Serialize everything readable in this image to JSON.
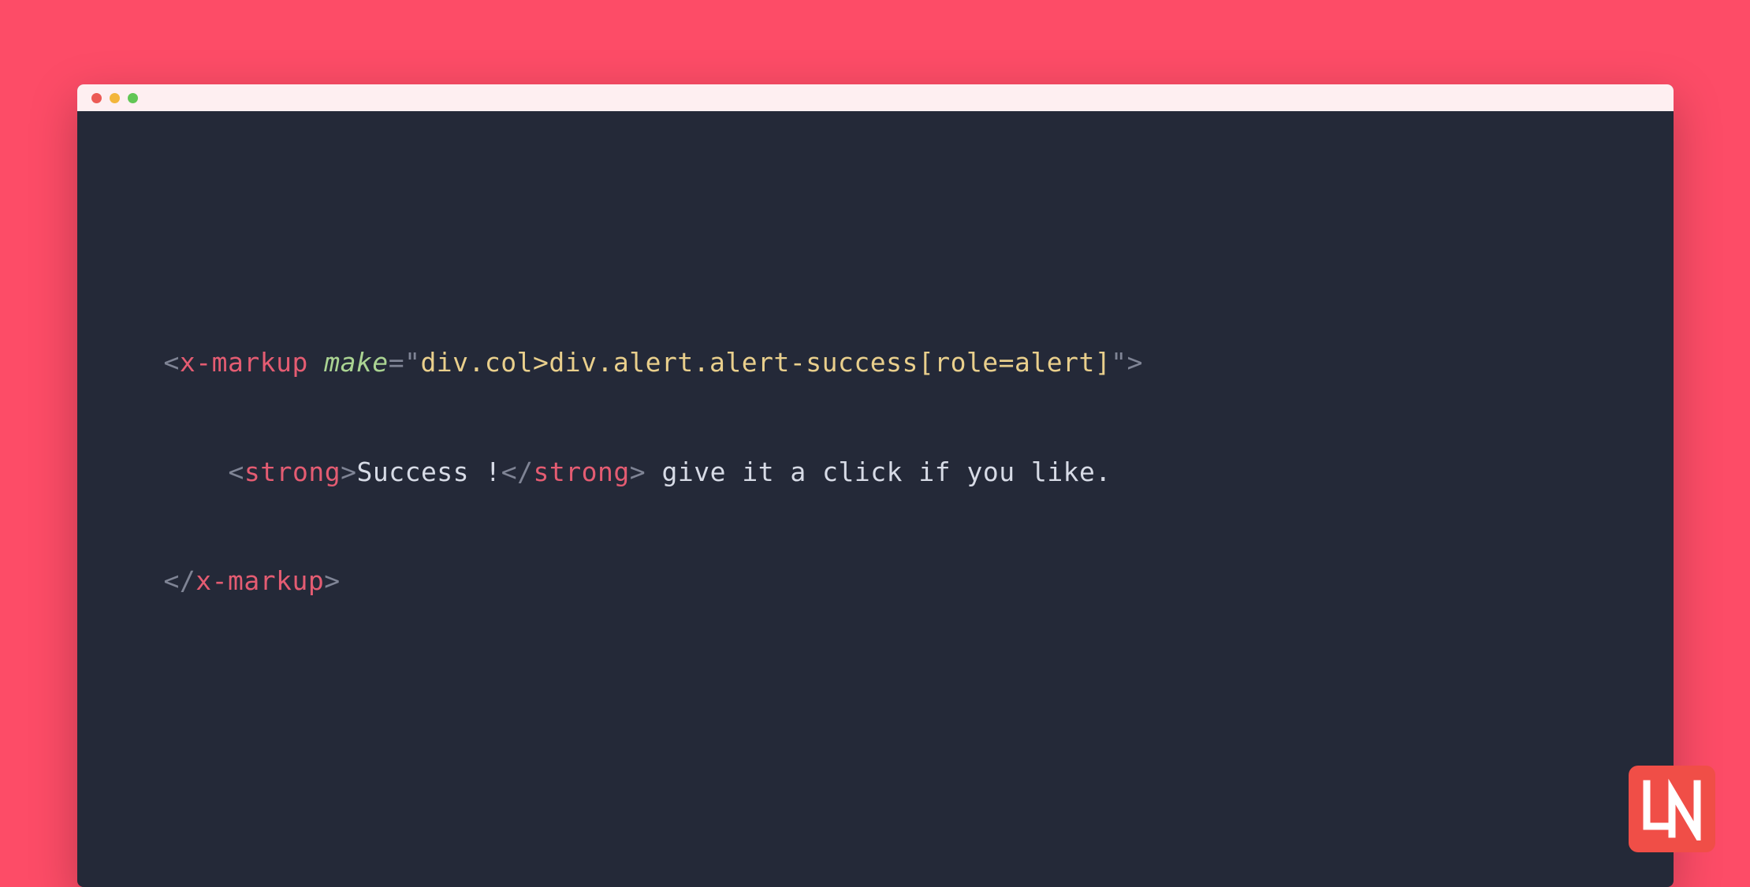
{
  "code": {
    "line1": {
      "open_bracket": "<",
      "tag": "x-markup",
      "attr_name": "make",
      "equals": "=",
      "quote_open": "\"",
      "attr_value": "div.col>div.alert.alert-success[role=alert]",
      "quote_close": "\"",
      "close_bracket": ">"
    },
    "line2": {
      "open_bracket": "<",
      "strong_open": "strong",
      "close_bracket": ">",
      "text1": "Success !",
      "close_open": "</",
      "strong_close": "strong",
      "close_bracket2": ">",
      "text2": " give it a click if you like."
    },
    "line3": {
      "close_open": "</",
      "tag": "x-markup",
      "close_bracket": ">"
    }
  },
  "logo": {
    "text": "LN"
  },
  "colors": {
    "bg": "#fd4c67",
    "editor_bg": "#242938",
    "titlebar_bg": "#feeff1",
    "punct": "#7f8495",
    "tag": "#e45c72",
    "attr": "#aad392",
    "string": "#e9cf8c",
    "text": "#d7dbe6",
    "logo_bg": "#f04e47"
  }
}
